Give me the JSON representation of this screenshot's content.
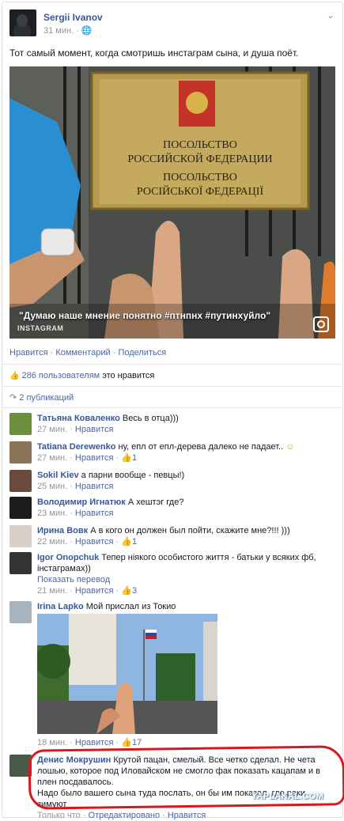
{
  "post": {
    "author": "Sergii Ivanov",
    "time": "31 мин.",
    "privacy_icon": "globe-icon",
    "status": "Тот самый момент, когда смотришь инстаграм сына, и душа поёт.",
    "photo": {
      "sign_line1": "ПОСОЛЬСТВО",
      "sign_line2": "РОССИЙСКОЙ ФЕДЕРАЦИИ",
      "sign_line3": "ПОСОЛЬСТВО",
      "sign_line4": "РОСІЙСЬКОЇ ФЕДЕРАЦІЇ",
      "caption": "\"Думаю наше мнение понятно #птнпнх #путинхуйло\"",
      "source": "INSTAGRAM"
    },
    "actions": {
      "like": "Нравится",
      "comment": "Комментарий",
      "share": "Поделиться",
      "dot": "·"
    },
    "likes_count": "286 пользователям",
    "likes_suffix": "это нравится",
    "shares": "2 публикаций"
  },
  "comments": [
    {
      "name": "Татьяна Коваленко",
      "text": "Весь в отца)))",
      "time": "27 мин.",
      "action": "Нравится",
      "likes": ""
    },
    {
      "name": "Tatiana Derewenko",
      "text": "ну, епл от епл-дерева далеко не падает..",
      "time": "27 мин.",
      "action": "Нравится",
      "likes": "1"
    },
    {
      "name": "Sokil Kiev",
      "text": "а парни вообще - певцы!)",
      "time": "25 мин.",
      "action": "Нравится",
      "likes": ""
    },
    {
      "name": "Володимир Игнатюк",
      "text": "А хештэг где?",
      "time": "23 мин.",
      "action": "Нравится",
      "likes": ""
    },
    {
      "name": "Ирина Вовк",
      "text": "А в кого он должен был пойти, скажите мне?!!! )))",
      "time": "22 мин.",
      "action": "Нравится",
      "likes": "1"
    },
    {
      "name": "Igor Onopchuk",
      "text": "Тепер ніякого особистого життя - батьки у всяких фб, інстаграмах))",
      "translate": "Показать перевод",
      "time": "21 мин.",
      "action": "Нравится",
      "likes": "3"
    },
    {
      "name": "Irina Lapko",
      "text": "Мой прислал из Токио",
      "time": "18 мин.",
      "action": "Нравится",
      "likes": "17"
    },
    {
      "name": "Денис Мокрушин",
      "text": "Крутой пацан, смелый. Все четко сделал. Не чета лошью, которое под Иловайском не смогло фак показать кацапам и в плен посдавалось.",
      "text2": "Надо было вашего сына туда послать, он бы им показал, где раки зимуют",
      "time": "Только что",
      "edit": "Отредактировано",
      "action": "Нравится"
    }
  ],
  "watermark": "YAPLAKAL.COM",
  "colors": {
    "link": "#365899",
    "meta": "#90949c",
    "highlight": "#d9181e"
  }
}
